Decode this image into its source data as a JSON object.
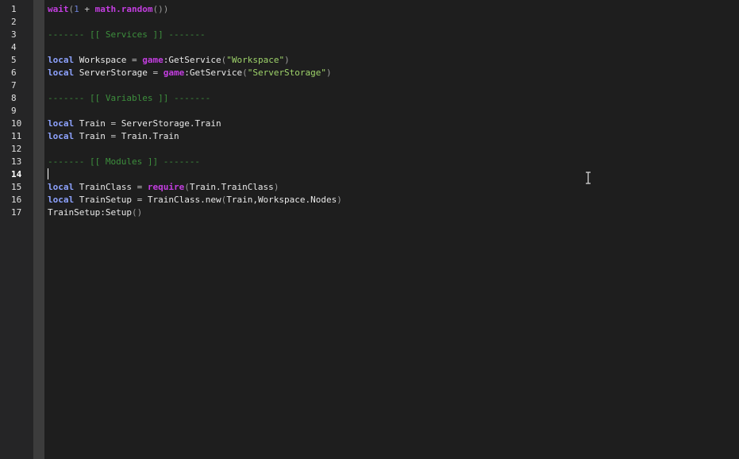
{
  "editor": {
    "current_line": 14,
    "lines": [
      {
        "number": "1",
        "tokens": [
          {
            "t": "wait",
            "c": "fn"
          },
          {
            "t": "(",
            "c": "paren"
          },
          {
            "t": "1",
            "c": "num"
          },
          {
            "t": " + ",
            "c": "op"
          },
          {
            "t": "math.random",
            "c": "fn"
          },
          {
            "t": "())",
            "c": "paren"
          }
        ]
      },
      {
        "number": "2",
        "tokens": []
      },
      {
        "number": "3",
        "tokens": [
          {
            "t": "------- [[ Services ]] -------",
            "c": "cmt"
          }
        ]
      },
      {
        "number": "4",
        "tokens": []
      },
      {
        "number": "5",
        "tokens": [
          {
            "t": "local",
            "c": "kw"
          },
          {
            "t": " Workspace ",
            "c": "id"
          },
          {
            "t": "=",
            "c": "op"
          },
          {
            "t": " ",
            "c": "id"
          },
          {
            "t": "game",
            "c": "fn"
          },
          {
            "t": ":GetService",
            "c": "id"
          },
          {
            "t": "(",
            "c": "paren"
          },
          {
            "t": "\"Workspace\"",
            "c": "str"
          },
          {
            "t": ")",
            "c": "paren"
          }
        ]
      },
      {
        "number": "6",
        "tokens": [
          {
            "t": "local",
            "c": "kw"
          },
          {
            "t": " ServerStorage ",
            "c": "id"
          },
          {
            "t": "=",
            "c": "op"
          },
          {
            "t": " ",
            "c": "id"
          },
          {
            "t": "game",
            "c": "fn"
          },
          {
            "t": ":GetService",
            "c": "id"
          },
          {
            "t": "(",
            "c": "paren"
          },
          {
            "t": "\"ServerStorage\"",
            "c": "str"
          },
          {
            "t": ")",
            "c": "paren"
          }
        ]
      },
      {
        "number": "7",
        "tokens": []
      },
      {
        "number": "8",
        "tokens": [
          {
            "t": "------- [[ Variables ]] -------",
            "c": "cmt"
          }
        ]
      },
      {
        "number": "9",
        "tokens": []
      },
      {
        "number": "10",
        "tokens": [
          {
            "t": "local",
            "c": "kw"
          },
          {
            "t": " Train ",
            "c": "id"
          },
          {
            "t": "=",
            "c": "op"
          },
          {
            "t": " ServerStorage.Train",
            "c": "id"
          }
        ]
      },
      {
        "number": "11",
        "tokens": [
          {
            "t": "local",
            "c": "kw"
          },
          {
            "t": " Train ",
            "c": "id"
          },
          {
            "t": "=",
            "c": "op"
          },
          {
            "t": " Train.Train",
            "c": "id"
          }
        ]
      },
      {
        "number": "12",
        "tokens": []
      },
      {
        "number": "13",
        "tokens": [
          {
            "t": "------- [[ Modules ]] -------",
            "c": "cmt"
          }
        ]
      },
      {
        "number": "14",
        "tokens": []
      },
      {
        "number": "15",
        "tokens": [
          {
            "t": "local",
            "c": "kw"
          },
          {
            "t": " TrainClass ",
            "c": "id"
          },
          {
            "t": "=",
            "c": "op"
          },
          {
            "t": " ",
            "c": "id"
          },
          {
            "t": "require",
            "c": "fn"
          },
          {
            "t": "(",
            "c": "paren"
          },
          {
            "t": "Train.TrainClass",
            "c": "id"
          },
          {
            "t": ")",
            "c": "paren"
          }
        ]
      },
      {
        "number": "16",
        "tokens": [
          {
            "t": "local",
            "c": "kw"
          },
          {
            "t": " TrainSetup ",
            "c": "id"
          },
          {
            "t": "=",
            "c": "op"
          },
          {
            "t": " TrainClass.new",
            "c": "id"
          },
          {
            "t": "(",
            "c": "paren"
          },
          {
            "t": "Train,Workspace.Nodes",
            "c": "id"
          },
          {
            "t": ")",
            "c": "paren"
          }
        ]
      },
      {
        "number": "17",
        "tokens": [
          {
            "t": "TrainSetup:Setup",
            "c": "id"
          },
          {
            "t": "()",
            "c": "paren"
          }
        ]
      }
    ]
  },
  "colors": {
    "background": "#1e1e1e",
    "gutter": "#252526",
    "keyword": "#8ea3ff",
    "builtin": "#c33ee0",
    "string": "#9ed36a",
    "comment": "#3d8f3d",
    "number": "#6b7fd6"
  },
  "cursor": {
    "icon": "text-ibeam-icon"
  }
}
